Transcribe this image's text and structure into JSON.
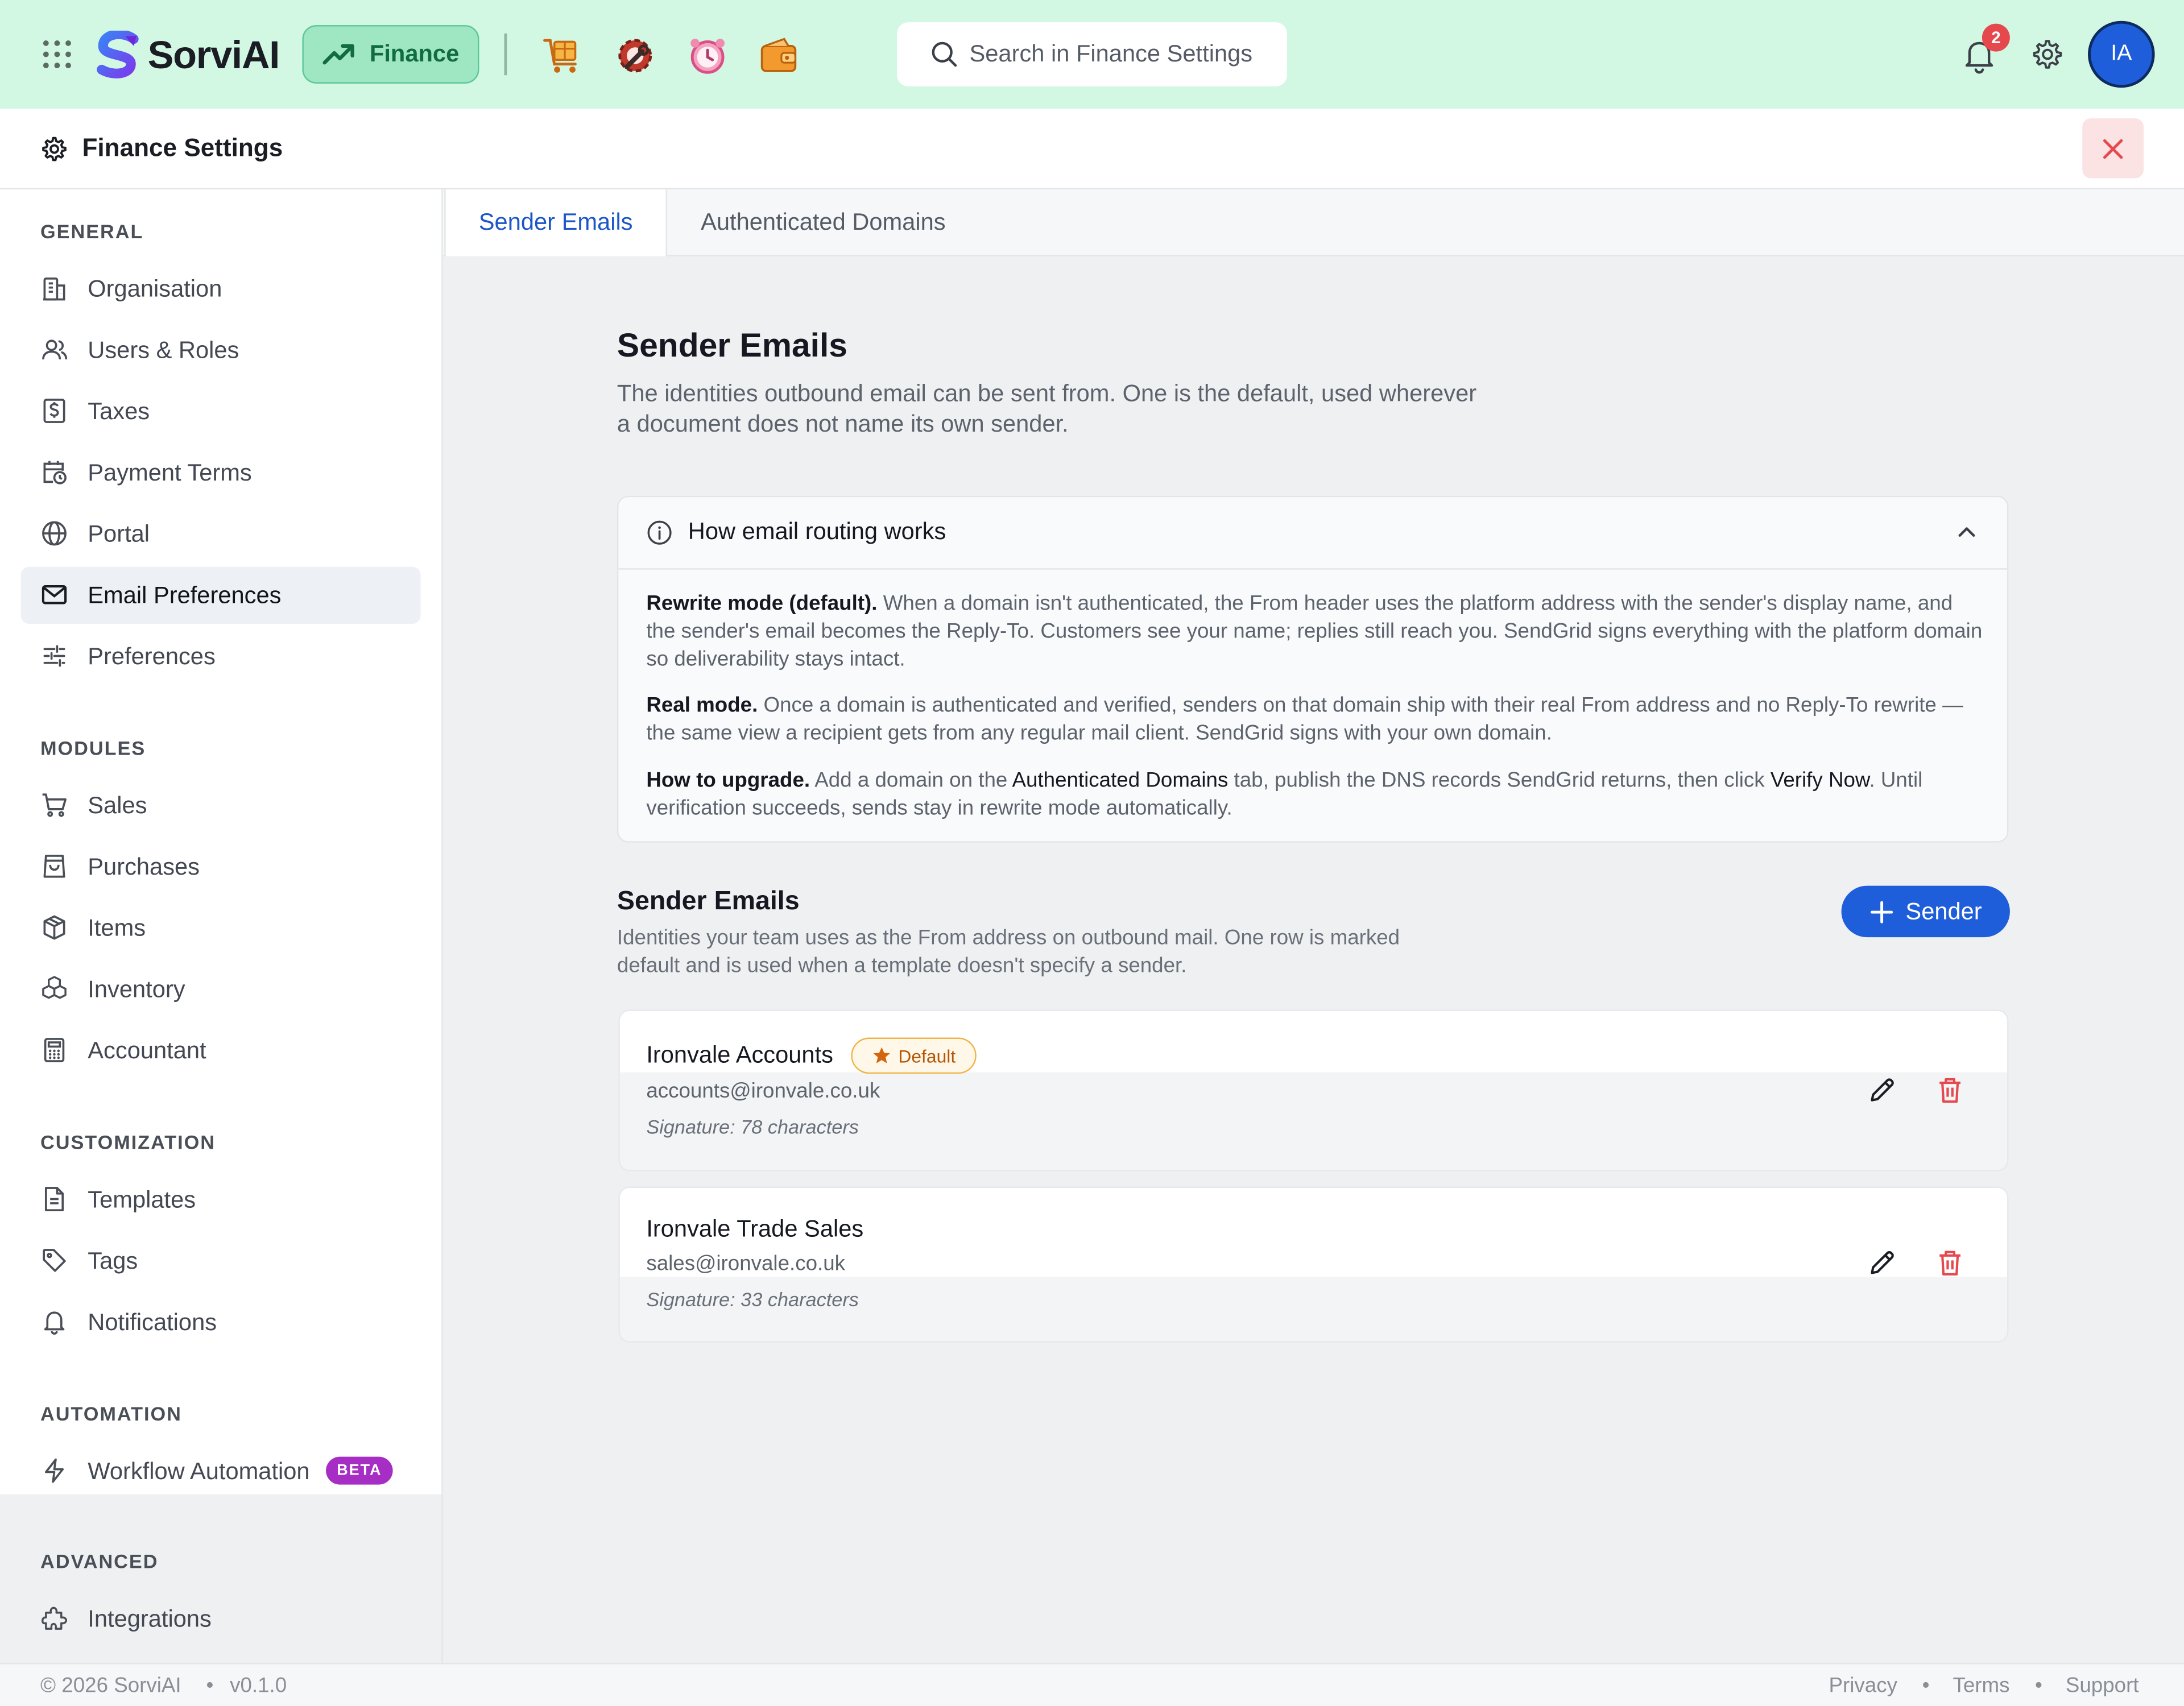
{
  "brand": {
    "name": "SorviAI",
    "accent": "#1f5edb",
    "topbar_bg": "#d2f8e4"
  },
  "topbar": {
    "app_label": "Finance",
    "module_icons": [
      "box-cart-icon",
      "gear-wrench-icon",
      "alarm-clock-icon",
      "wallet-icon"
    ],
    "search_placeholder": "Search in Finance Settings",
    "notification_count": "2",
    "avatar_initials": "IA"
  },
  "page": {
    "title": "Finance Settings"
  },
  "sidebar": {
    "sections": {
      "general": "GENERAL",
      "modules": "MODULES",
      "customization": "CUSTOMIZATION",
      "automation": "AUTOMATION",
      "advanced": "ADVANCED"
    },
    "items": [
      {
        "label": "Organisation",
        "icon": "building-icon"
      },
      {
        "label": "Users & Roles",
        "icon": "users-icon"
      },
      {
        "label": "Taxes",
        "icon": "dollar-doc-icon"
      },
      {
        "label": "Payment Terms",
        "icon": "calendar-clock-icon"
      },
      {
        "label": "Portal",
        "icon": "globe-icon"
      },
      {
        "label": "Email Preferences",
        "icon": "mail-icon",
        "active": true
      },
      {
        "label": "Preferences",
        "icon": "sliders-icon"
      },
      {
        "label": "Sales",
        "icon": "cart-icon"
      },
      {
        "label": "Purchases",
        "icon": "bag-icon"
      },
      {
        "label": "Items",
        "icon": "cube-icon"
      },
      {
        "label": "Inventory",
        "icon": "boxes-icon"
      },
      {
        "label": "Accountant",
        "icon": "calculator-icon"
      },
      {
        "label": "Templates",
        "icon": "document-icon"
      },
      {
        "label": "Tags",
        "icon": "tag-icon"
      },
      {
        "label": "Notifications",
        "icon": "bell-icon"
      },
      {
        "label": "Workflow Automation",
        "icon": "lightning-icon",
        "badge": "BETA"
      },
      {
        "label": "Integrations",
        "icon": "puzzle-icon"
      }
    ]
  },
  "tabs": [
    {
      "label": "Sender Emails",
      "active": true
    },
    {
      "label": "Authenticated Domains",
      "active": false
    }
  ],
  "main": {
    "title": "Sender Emails",
    "description": "The identities outbound email can be sent from. One is the default, used wherever a document does not name its own sender.",
    "info": {
      "title": "How email routing works",
      "p1_bold": "Rewrite mode (default).",
      "p1_text": " When a domain isn't authenticated, the From header uses the platform address with the sender's display name, and the sender's email becomes the Reply-To. Customers see your name; replies still reach you. SendGrid signs everything with the platform domain so deliverability stays intact.",
      "p2_bold": "Real mode.",
      "p2_text": " Once a domain is authenticated and verified, senders on that domain ship with their real From address and no Reply-To rewrite — the same view a recipient gets from any regular mail client. SendGrid signs with your own domain.",
      "p3_bold": "How to upgrade.",
      "p3_text_a": " Add a domain on the ",
      "p3_link_a": "Authenticated Domains",
      "p3_text_b": " tab, publish the DNS records SendGrid returns, then click ",
      "p3_link_b": "Verify Now",
      "p3_text_c": ". Until verification succeeds, sends stay in rewrite mode automatically."
    },
    "list_title": "Sender Emails",
    "list_description": "Identities your team uses as the From address on outbound mail. One row is marked default and is used when a template doesn't specify a sender.",
    "add_button": "Sender",
    "senders": [
      {
        "name": "Ironvale Accounts",
        "email": "accounts@ironvale.co.uk",
        "signature": "Signature: 78 characters",
        "badge": "Default"
      },
      {
        "name": "Ironvale Trade Sales",
        "email": "sales@ironvale.co.uk",
        "signature": "Signature: 33 characters"
      }
    ]
  },
  "footer": {
    "copyright": "© 2026 SorviAI",
    "version": "v0.1.0",
    "links": [
      "Privacy",
      "Terms",
      "Support"
    ]
  }
}
